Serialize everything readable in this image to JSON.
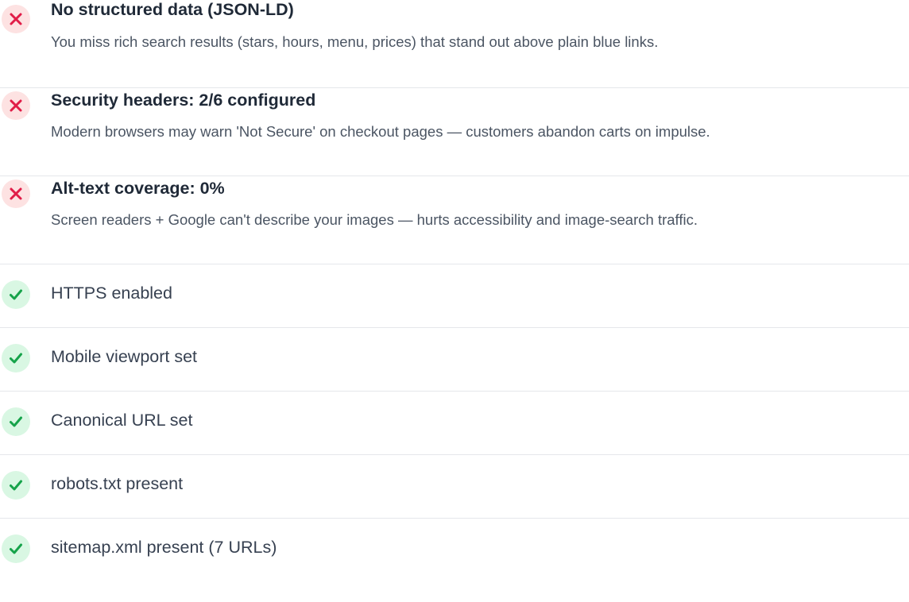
{
  "issues": [
    {
      "title": "No structured data (JSON-LD)",
      "description": "You miss rich search results (stars, hours, menu, prices) that stand out above plain blue links.",
      "status": "fail",
      "icon": "x-icon"
    },
    {
      "title": "Security headers: 2/6 configured",
      "description": "Modern browsers may warn 'Not Secure' on checkout pages — customers abandon carts on impulse.",
      "status": "fail",
      "icon": "x-icon"
    },
    {
      "title": "Alt-text coverage: 0%",
      "description": "Screen readers + Google can't describe your images — hurts accessibility and image-search traffic.",
      "status": "fail",
      "icon": "x-icon"
    }
  ],
  "passes": [
    {
      "label": "HTTPS enabled",
      "status": "pass",
      "icon": "check-icon"
    },
    {
      "label": "Mobile viewport set",
      "status": "pass",
      "icon": "check-icon"
    },
    {
      "label": "Canonical URL set",
      "status": "pass",
      "icon": "check-icon"
    },
    {
      "label": "robots.txt present",
      "status": "pass",
      "icon": "check-icon"
    },
    {
      "label": "sitemap.xml present (7 URLs)",
      "status": "pass",
      "icon": "check-icon"
    }
  ],
  "colors": {
    "fail_icon": "#e11d48",
    "fail_badge_bg": "#fde2e2",
    "pass_icon": "#16a34a",
    "pass_badge_bg": "#d9f7e3",
    "divider": "#e5e7eb"
  }
}
